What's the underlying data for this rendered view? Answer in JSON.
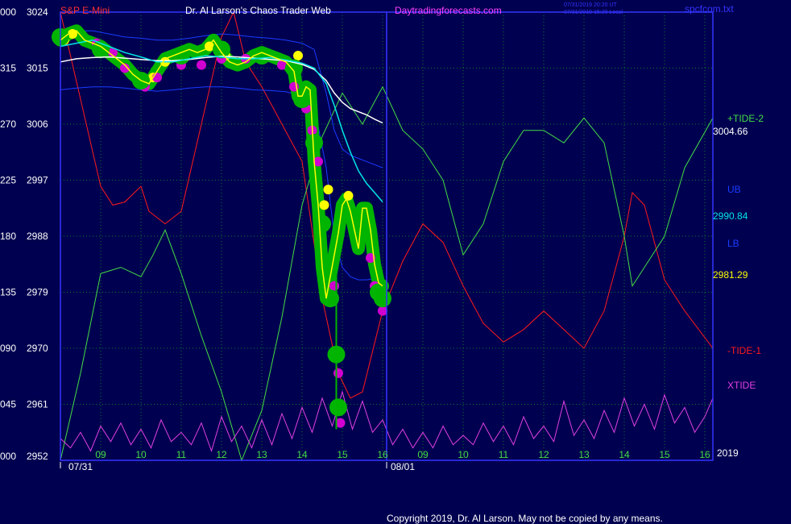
{
  "header": {
    "symbol": "S&P E-Mini",
    "site_title": "Dr. Al Larson's Chaos Trader Web",
    "site_url": "Daytradingforecasts.com",
    "stamp_line1": "07/31/2019 20:20 UT",
    "stamp_line2": "07/31/2019 15:20 Local",
    "filename": "spcfcom.txt"
  },
  "footer": {
    "copyright": "Copyright 2019, Dr. Al Larson. May not be copied by any means."
  },
  "right_labels": {
    "tide2": "+TIDE-2",
    "tide2_value": "3004.66",
    "ub": "UB",
    "ub_value": "2990.84",
    "lb": "LB",
    "lb_value": "2981.29",
    "tide1": "-TIDE-1",
    "xtide": "XTIDE",
    "year": "2019"
  },
  "colors": {
    "background": "#000050",
    "plot_border": "#3434ff",
    "grid": "#0b7a2a",
    "price": "#ffff00",
    "green_band": "#00b400",
    "magenta": "#d000d0",
    "cyan": "#00e6e6",
    "white": "#ffffff",
    "blue_band": "#1a3cff",
    "red_tide": "#ff1a1a",
    "green_tide": "#44dd44",
    "xtide": "#e040e0",
    "title_red": "#ff3030",
    "title_white": "#ffffff",
    "title_magenta": "#ff40ff"
  },
  "chart_data": {
    "type": "line",
    "title": "S&P E-Mini",
    "ylim": [
      2952,
      3024
    ],
    "y_ticks_right": [
      "3024",
      "3015",
      "3006",
      "2997",
      "2988",
      "2979",
      "2970",
      "2961",
      "2952"
    ],
    "y_ticks_left": [
      "000",
      "315",
      "270",
      "225",
      "180",
      "135",
      "090",
      "045",
      "000"
    ],
    "x_ticks": [
      {
        "x": 9,
        "label": "09"
      },
      {
        "x": 10,
        "label": "10"
      },
      {
        "x": 11,
        "label": "11"
      },
      {
        "x": 12,
        "label": "12"
      },
      {
        "x": 13,
        "label": "13"
      },
      {
        "x": 14,
        "label": "14"
      },
      {
        "x": 15,
        "label": "15"
      },
      {
        "x": 16,
        "label": "16"
      },
      {
        "x": 17,
        "label": "09"
      },
      {
        "x": 18,
        "label": "10"
      },
      {
        "x": 19,
        "label": "11"
      },
      {
        "x": 20,
        "label": "12"
      },
      {
        "x": 21,
        "label": "13"
      },
      {
        "x": 22,
        "label": "14"
      },
      {
        "x": 23,
        "label": "15"
      },
      {
        "x": 24,
        "label": "16"
      }
    ],
    "dates": [
      {
        "x": 8.5,
        "label": "07/31"
      },
      {
        "x": 16.5,
        "label": "08/01"
      }
    ],
    "xlim": [
      8.0,
      24.2
    ],
    "grid": true,
    "series": [
      {
        "name": "S&P E-Mini",
        "x": [
          8.0,
          8.2,
          8.4,
          8.6,
          8.8,
          9.0,
          9.2,
          9.4,
          9.6,
          9.8,
          10.0,
          10.2,
          10.4,
          10.6,
          10.8,
          11.0,
          11.2,
          11.4,
          11.6,
          11.8,
          12.0,
          12.2,
          12.4,
          12.6,
          12.8,
          13.0,
          13.2,
          13.4,
          13.6,
          13.8,
          13.9,
          14.0,
          14.1,
          14.2,
          14.3,
          14.4,
          14.5,
          14.6,
          14.7,
          14.8,
          14.9,
          15.0,
          15.1,
          15.2,
          15.3,
          15.4,
          15.5,
          15.6,
          15.7,
          15.8,
          15.9,
          16.0
        ],
        "y": [
          3019.5,
          3020.5,
          3021.0,
          3019.5,
          3019.0,
          3018.5,
          3017.5,
          3016.5,
          3015.5,
          3014.0,
          3013.0,
          3012.5,
          3014.5,
          3016.5,
          3017.0,
          3017.5,
          3018.0,
          3017.5,
          3018.0,
          3019.5,
          3017.5,
          3016.0,
          3015.5,
          3016.0,
          3017.0,
          3017.5,
          3017.0,
          3016.5,
          3016.0,
          3014.5,
          3010.5,
          3010.5,
          3012.0,
          3011.5,
          3000.0,
          2993.0,
          2983.0,
          2978.0,
          2981.5,
          2985.0,
          2988.5,
          2993.0,
          2994.0,
          2992.0,
          2989.0,
          2986.0,
          2992.5,
          2992.5,
          2989.0,
          2983.5,
          2980.5,
          2980.0
        ]
      },
      {
        "name": "",
        "x": [
          8.0,
          8.4,
          8.8,
          9.2,
          9.6,
          10.0,
          10.4,
          10.8,
          11.2,
          11.6,
          12.0,
          12.4,
          12.8,
          13.2,
          13.6,
          14.0,
          14.3,
          14.6,
          14.8,
          15.0,
          15.2,
          15.4,
          15.6,
          15.8,
          16.0
        ],
        "y": [
          3018.5,
          3019.0,
          3019.5,
          3018.5,
          3017.5,
          3016.8,
          3016.0,
          3016.0,
          3016.5,
          3017.0,
          3016.8,
          3016.5,
          3016.5,
          3016.7,
          3016.3,
          3015.8,
          3015.0,
          3012.5,
          3009.0,
          3005.0,
          3001.5,
          2998.5,
          2996.5,
          2995.0,
          2993.5
        ]
      },
      {
        "name": "",
        "x": [
          8.0,
          8.4,
          8.8,
          9.2,
          9.6,
          10.0,
          10.4,
          10.8,
          11.2,
          11.6,
          12.0,
          12.4,
          12.8,
          13.2,
          13.6,
          14.0,
          14.3,
          14.6,
          14.8,
          15.0,
          15.2,
          15.4,
          15.6,
          15.8,
          16.0
        ],
        "y": [
          3016.0,
          3016.5,
          3016.7,
          3016.8,
          3016.6,
          3016.4,
          3016.2,
          3016.2,
          3016.4,
          3016.7,
          3016.9,
          3016.8,
          3016.6,
          3016.4,
          3016.2,
          3015.6,
          3014.8,
          3013.0,
          3011.0,
          3009.5,
          3008.5,
          3008.0,
          3007.5,
          3006.8,
          3006.2
        ]
      },
      {
        "name": "UB",
        "x": [
          8.0,
          8.4,
          8.8,
          9.2,
          9.6,
          10.0,
          10.4,
          10.8,
          11.2,
          11.6,
          12.0,
          12.4,
          12.8,
          13.2,
          13.6,
          14.0,
          14.3,
          14.6,
          14.8,
          15.0,
          15.2,
          15.4,
          15.6,
          15.8,
          16.0
        ],
        "y": [
          3020.5,
          3021.0,
          3021.0,
          3020.5,
          3020.0,
          3019.8,
          3019.5,
          3019.5,
          3019.8,
          3020.2,
          3020.5,
          3020.3,
          3020.0,
          3019.8,
          3019.5,
          3019.0,
          3018.0,
          3011.0,
          3005.0,
          3002.0,
          3001.0,
          3000.5,
          3000.0,
          2999.5,
          2999.0
        ]
      },
      {
        "name": "LB",
        "x": [
          8.0,
          8.4,
          8.8,
          9.2,
          9.6,
          10.0,
          10.4,
          10.8,
          11.2,
          11.6,
          12.0,
          12.4,
          12.8,
          13.2,
          13.6,
          14.0,
          14.3,
          14.6,
          14.8,
          15.0,
          15.2,
          15.4,
          15.6,
          15.8,
          16.0
        ],
        "y": [
          3011.5,
          3011.8,
          3012.0,
          3012.0,
          3011.8,
          3011.5,
          3011.3,
          3011.5,
          3011.8,
          3012.0,
          3012.0,
          3011.8,
          3011.5,
          3011.4,
          3011.2,
          3010.5,
          3009.0,
          2999.0,
          2988.0,
          2983.0,
          2981.5,
          2981.0,
          2981.0,
          2981.2,
          2981.3
        ]
      },
      {
        "name": "-TIDE-1",
        "x": [
          8.0,
          8.5,
          9.0,
          9.3,
          9.6,
          10.0,
          10.2,
          10.6,
          11.0,
          11.5,
          12.0,
          12.3,
          12.6,
          13.0,
          13.5,
          14.0,
          14.5,
          14.9,
          15.2,
          15.5,
          16.0,
          16.5,
          17.0,
          17.5,
          18.0,
          18.5,
          19.0,
          19.5,
          20.0,
          20.5,
          21.0,
          21.5,
          22.0,
          22.2,
          22.5,
          23.0,
          23.5,
          24.2
        ],
        "y": [
          3024.0,
          3010.0,
          2996.0,
          2993.0,
          2993.5,
          2996.0,
          2992.0,
          2990.0,
          2992.0,
          3006.0,
          3020.0,
          3024.0,
          3016.0,
          3012.0,
          3006.0,
          3000.0,
          2978.0,
          2966.0,
          2962.0,
          2963.0,
          2976.0,
          2984.0,
          2990.0,
          2987.0,
          2980.0,
          2974.0,
          2971.0,
          2973.0,
          2976.0,
          2973.0,
          2970.0,
          2976.0,
          2988.0,
          2995.0,
          2993.0,
          2981.0,
          2976.0,
          2970.0
        ]
      },
      {
        "name": "+TIDE-2",
        "x": [
          8.0,
          8.5,
          9.0,
          9.5,
          10.0,
          10.3,
          10.6,
          11.0,
          11.5,
          12.0,
          12.5,
          13.0,
          13.5,
          14.0,
          14.5,
          15.0,
          15.5,
          16.0,
          16.5,
          17.0,
          17.5,
          18.0,
          18.5,
          19.0,
          19.5,
          20.0,
          20.5,
          21.0,
          21.5,
          22.0,
          22.2,
          22.5,
          23.0,
          23.5,
          24.2
        ],
        "y": [
          2952.0,
          2966.0,
          2982.0,
          2983.0,
          2981.5,
          2985.0,
          2989.0,
          2982.0,
          2972.0,
          2963.0,
          2952.0,
          2960.0,
          2975.0,
          2993.0,
          3004.0,
          3011.0,
          3006.0,
          3012.0,
          3005.0,
          3002.0,
          2997.0,
          2985.0,
          2990.0,
          3000.0,
          3005.0,
          3005.0,
          3003.0,
          3007.0,
          3003.0,
          2988.0,
          2980.0,
          2983.0,
          2988.0,
          2999.0,
          3007.0
        ]
      },
      {
        "name": "XTIDE",
        "x": [
          8.0,
          8.25,
          8.5,
          8.75,
          9.0,
          9.25,
          9.5,
          9.75,
          10.0,
          10.25,
          10.5,
          10.75,
          11.0,
          11.25,
          11.5,
          11.75,
          12.0,
          12.25,
          12.5,
          12.75,
          13.0,
          13.25,
          13.5,
          13.75,
          14.0,
          14.25,
          14.5,
          14.75,
          15.0,
          15.25,
          15.5,
          15.75,
          16.0,
          16.25,
          16.5,
          16.75,
          17.0,
          17.25,
          17.5,
          17.75,
          18.0,
          18.25,
          18.5,
          18.75,
          19.0,
          19.25,
          19.5,
          19.75,
          20.0,
          20.25,
          20.5,
          20.75,
          21.0,
          21.25,
          21.5,
          21.75,
          22.0,
          22.25,
          22.5,
          22.75,
          23.0,
          23.25,
          23.5,
          23.75,
          24.0,
          24.2
        ],
        "y": [
          2955.5,
          2954.0,
          2956.5,
          2953.5,
          2957.5,
          2955.0,
          2958.0,
          2954.5,
          2957.0,
          2954.0,
          2958.5,
          2955.0,
          2956.5,
          2954.5,
          2958.0,
          2953.5,
          2959.0,
          2955.0,
          2957.5,
          2954.0,
          2958.5,
          2954.5,
          2959.5,
          2955.5,
          2960.5,
          2956.5,
          2962.0,
          2957.5,
          2963.0,
          2957.0,
          2961.5,
          2956.5,
          2958.5,
          2954.5,
          2957.0,
          2954.0,
          2956.5,
          2954.0,
          2957.5,
          2954.5,
          2956.0,
          2954.5,
          2958.0,
          2955.0,
          2957.5,
          2954.5,
          2959.0,
          2955.5,
          2957.5,
          2955.0,
          2961.5,
          2956.0,
          2958.5,
          2955.5,
          2960.0,
          2956.5,
          2962.0,
          2957.5,
          2961.0,
          2957.0,
          2962.5,
          2958.0,
          2960.5,
          2956.5,
          2959.0,
          2962.0
        ]
      }
    ],
    "markers": [
      {
        "series": "yellow",
        "x": [
          8.1,
          8.3,
          9.9,
          10.3,
          10.6,
          11.0,
          11.7,
          12.1,
          13.9,
          14.55,
          14.65,
          15.15
        ],
        "y": [
          3019.5,
          3020.5,
          3013.0,
          3013.5,
          3016.0,
          3017.5,
          3018.5,
          3017.0,
          3017.0,
          2993.0,
          2995.5,
          2994.5
        ]
      },
      {
        "series": "magenta",
        "x": [
          8.9,
          9.3,
          9.6,
          10.1,
          10.4,
          11.0,
          11.5,
          12.0,
          12.6,
          13.5,
          13.8,
          14.1,
          14.25,
          14.4,
          14.6,
          14.8,
          14.9,
          14.95,
          15.7,
          15.8,
          16.0
        ],
        "y": [
          3019.0,
          3017.5,
          3015.0,
          3012.0,
          3013.5,
          3015.5,
          3015.5,
          3016.5,
          3016.5,
          3015.5,
          3012.0,
          3008.5,
          3005.0,
          3000.0,
          2990.0,
          2980.0,
          2966.0,
          2958.0,
          2984.5,
          2980.0,
          2976.0
        ]
      },
      {
        "series": "green",
        "x": [
          8.0,
          9.0,
          10.0,
          11.0,
          12.0,
          13.0,
          13.8,
          14.0,
          14.3,
          14.5,
          14.7,
          14.85,
          14.9,
          15.3,
          15.6,
          15.9,
          16.0
        ],
        "y": [
          3020.0,
          3018.0,
          3013.0,
          3017.0,
          3018.0,
          3017.0,
          3015.0,
          3010.0,
          3003.0,
          2990.0,
          2978.0,
          2969.0,
          2960.5,
          2991.0,
          2990.0,
          2979.0,
          2978.0
        ]
      }
    ]
  }
}
